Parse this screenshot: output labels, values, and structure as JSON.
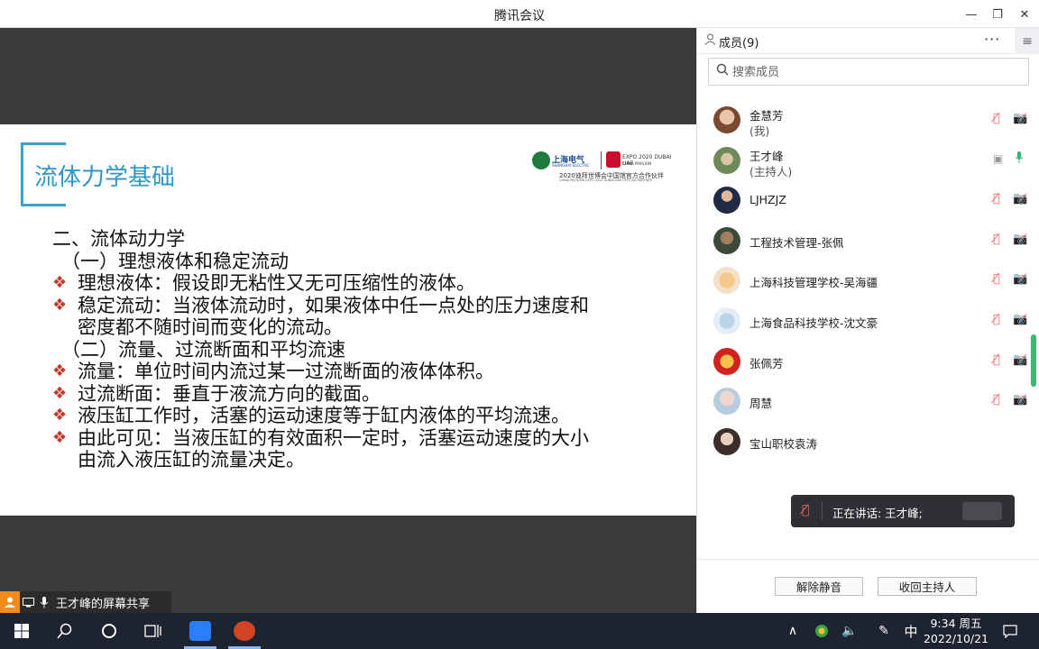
{
  "window": {
    "title": "腾讯会议"
  },
  "slide": {
    "title": "流体力学基础",
    "logo": {
      "brand_cn": "上海电气",
      "brand_en": "SHANGHAI ELECTRIC",
      "expo": "EXPO 2020 DUBAI UAE",
      "pavilion": "CHINA PAVILION",
      "partner_cn": "2020迪拜世博会中国馆官方合作伙伴",
      "partner_en": "CHINA PAVILION EXPO 2020 DUBAI UAE OFFICIAL PARTNER"
    },
    "lines": {
      "h1": "二、流体动力学",
      "h2": "（一）理想液体和稳定流动",
      "b1": "理想液体：假设即无粘性又无可压缩性的液体。",
      "b2": "稳定流动：当液体流动时，如果液体中任一点处的压力速度和",
      "b2c": "密度都不随时间而变化的流动。",
      "h3": "（二）流量、过流断面和平均流速",
      "b3": "流量：单位时间内流过某一过流断面的液体体积。",
      "b4": "过流断面：垂直于液流方向的截面。",
      "b5": "液压缸工作时，活塞的运动速度等于缸内液体的平均流速。",
      "b6": "由此可见：当液压缸的有效面积一定时，活塞运动速度的大小",
      "b6c": "由流入液压缸的流量决定。"
    },
    "bullet_glyph": "❖"
  },
  "share_label": "王才峰的屏幕共享",
  "panel": {
    "title": "成员(9)",
    "search_placeholder": "搜索成员",
    "members": [
      {
        "name": "金慧芳",
        "role": "(我)"
      },
      {
        "name": "王才峰",
        "role": "(主持人)"
      },
      {
        "name": "LJHZJZ"
      },
      {
        "name": "工程技术管理-张佩"
      },
      {
        "name": "上海科技管理学校-吴海疆"
      },
      {
        "name": "上海食品科技学校-沈文豪"
      },
      {
        "name": "张佩芳"
      },
      {
        "name": "周慧"
      },
      {
        "name": "宝山职校袁涛"
      }
    ],
    "speaking": "正在讲话: 王才峰;",
    "buttons": {
      "unmute": "解除静音",
      "reclaim_host": "收回主持人"
    }
  },
  "taskbar": {
    "ime": "中",
    "time": "9:34 周五",
    "date": "2022/10/21"
  },
  "colors": {
    "slide_title": "#2e97c9",
    "bullet": "#c0392b",
    "active_green": "#34b36a",
    "muted_red": "#e66666",
    "share_bg": "#3a3b3d",
    "taskbar_bg": "#1d2430"
  }
}
